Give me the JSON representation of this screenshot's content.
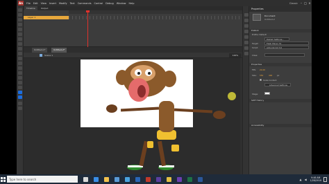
{
  "app": {
    "logo": "An",
    "menus": [
      "File",
      "Edit",
      "View",
      "Insert",
      "Modify",
      "Text",
      "Commands",
      "Control",
      "Debug",
      "Window",
      "Help"
    ],
    "workspace": "Classic"
  },
  "timeline": {
    "tabs": [
      "Timeline",
      "Output"
    ],
    "layer_name": "Layer 1"
  },
  "document": {
    "tabs": [
      "Untitled-1*",
      "Untitled-2*"
    ],
    "scene": "Scene 1",
    "zoom": "100%"
  },
  "properties": {
    "title": "Properties",
    "doc_type": "Document",
    "doc_file": "Untitled-2",
    "sections": {
      "publish": "Publish",
      "properties": "Properties",
      "swf_history": "SWF History",
      "accessibility": "Accessibility"
    },
    "publish_rows": {
      "profile_label": "Profile: Default",
      "settings_button": "Publish Settings...",
      "target_label": "Target:",
      "target_value": "Flash Player 31",
      "script_label": "Script:",
      "script_value": "ActionScript 3.0",
      "class_label": "Class:"
    },
    "props_rows": {
      "fps_label": "FPS:",
      "fps_value": "24.00",
      "size_label": "Size:",
      "size_w": "550",
      "size_h": "400",
      "size_unit": "px",
      "scale_content": "Scale Content",
      "advanced_settings": "Advanced Settings",
      "stage_label": "Stage:"
    }
  },
  "taskbar": {
    "search_placeholder": "Type here to search",
    "time": "9:46 AM",
    "date": "1/28/2019",
    "icons": [
      {
        "name": "task-view-icon",
        "color": "#d9d9d9"
      },
      {
        "name": "edge-icon",
        "color": "#3a8ee6"
      },
      {
        "name": "file-explorer-icon",
        "color": "#f2c14e"
      },
      {
        "name": "store-icon",
        "color": "#5a9ad6"
      },
      {
        "name": "mail-icon",
        "color": "#4aa3df"
      },
      {
        "name": "photoshop-icon",
        "color": "#2a66b5"
      },
      {
        "name": "animate-icon",
        "color": "#c0392b"
      },
      {
        "name": "media-encoder-icon",
        "color": "#5b3fa0"
      },
      {
        "name": "chrome-icon",
        "color": "#e2c044"
      },
      {
        "name": "premiere-icon",
        "color": "#6c3fb0"
      },
      {
        "name": "excel-icon",
        "color": "#1e7145"
      },
      {
        "name": "word-icon",
        "color": "#2b579a"
      }
    ]
  },
  "colors": {
    "app_bg": "#3b3b3b",
    "stage_bg": "#ffffff",
    "layer_accent": "#e8a83c",
    "playhead": "#e0322c",
    "taskbar": "#1f2b3a"
  }
}
